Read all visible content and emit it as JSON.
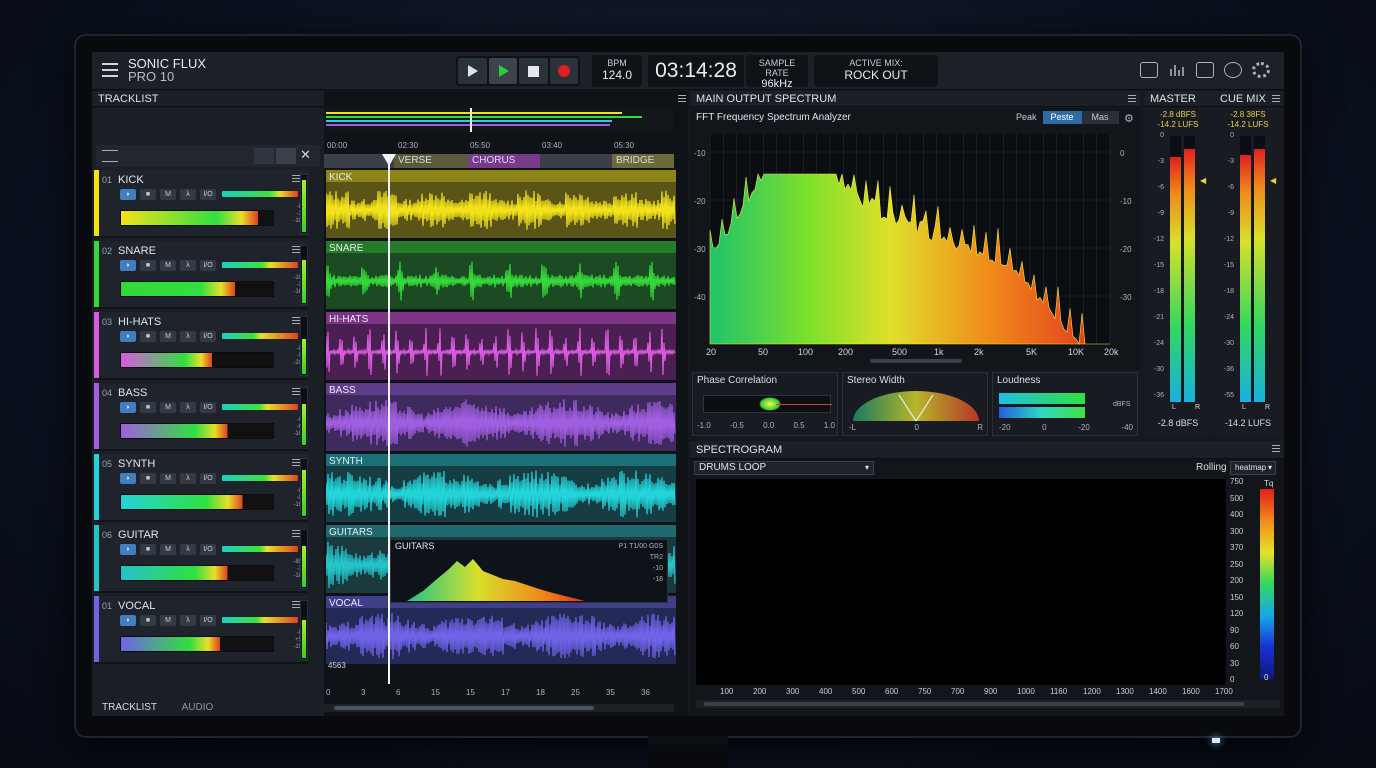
{
  "app": {
    "name_line1": "SONIC FLUX",
    "name_line2": "PRO 10"
  },
  "transport": {
    "bpm_label": "BPM",
    "bpm_value": "124.0",
    "time": "03:14:28",
    "sample_rate_label": "SAMPLE RATE",
    "sample_rate_value": "96kHz",
    "active_mix_label": "ACTIVE MIX:",
    "active_mix_value": "ROCK OUT"
  },
  "tracklist": {
    "title": "TRACKLIST",
    "footer_tabs": [
      "TRACKLIST",
      "AUDIO"
    ]
  },
  "timeline": {
    "times": [
      "00:00",
      "02:30",
      "05:50",
      "03:40",
      "05:30"
    ],
    "markers": [
      "VERSE",
      "CHORUS",
      "BRIDGE"
    ],
    "bottom_ticks": [
      "0",
      "3",
      "6",
      "15",
      "15",
      "17",
      "18",
      "25",
      "35",
      "36"
    ]
  },
  "tracks": [
    {
      "num": "01",
      "name": "KICK",
      "color": "#f2e21a",
      "levels": [
        "-8",
        "-3",
        "-10"
      ],
      "meter": 0.9
    },
    {
      "num": "02",
      "name": "SNARE",
      "color": "#35d83a",
      "levels": [
        "-10",
        "-3",
        "-16"
      ],
      "meter": 0.75
    },
    {
      "num": "03",
      "name": "HI-HATS",
      "color": "#d95be0",
      "levels": [
        "-8",
        "-5",
        "-20"
      ],
      "meter": 0.6
    },
    {
      "num": "04",
      "name": "BASS",
      "color": "#a05ee0",
      "levels": [
        "-8",
        "-6",
        "-10"
      ],
      "meter": 0.7
    },
    {
      "num": "05",
      "name": "SYNTH",
      "color": "#22d4d8",
      "levels": [
        "-8",
        "-0",
        "-16"
      ],
      "meter": 0.8
    },
    {
      "num": "06",
      "name": "GUITAR",
      "color": "#24c3c9",
      "levels": [
        "-89",
        "-3",
        "-18"
      ],
      "meter": 0.7
    },
    {
      "num": "01",
      "name": "VOCAL",
      "color": "#6f63e6",
      "levels": [
        "-8",
        "+5",
        "-15"
      ],
      "meter": 0.65
    }
  ],
  "lanes": [
    "KICK",
    "SNARE",
    "HI-HATS",
    "BASS",
    "SYNTH",
    "GUITARS",
    "VOCAL"
  ],
  "guitar_inset": {
    "title": "GUITARS",
    "labels": [
      "-10",
      "-15",
      "-20",
      "-30",
      "-35"
    ],
    "right": [
      "P1",
      "T1/00",
      "G0S",
      "TR2",
      "-10",
      "-18"
    ]
  },
  "vocal_tag": "4563",
  "main_spectrum": {
    "title": "MAIN OUTPUT SPECTRUM",
    "subtitle": "FFT Frequency Spectrum Analyzer",
    "modes": [
      "Peak",
      "Peste",
      "Mas"
    ],
    "y_left": [
      "-10",
      "-20",
      "-30",
      "-40"
    ],
    "y_right": [
      "0",
      "-10",
      "-20",
      "-30"
    ],
    "x": [
      "20",
      "50",
      "100",
      "200",
      "500",
      "1k",
      "2k",
      "5K",
      "10K",
      "20k"
    ]
  },
  "phase": {
    "title": "Phase Correlation",
    "ticks": [
      "-1.0",
      "-0.5",
      "0.0",
      "0.5",
      "1.0"
    ]
  },
  "stereo": {
    "title": "Stereo Width",
    "ticks": [
      "-L",
      "0",
      "R"
    ]
  },
  "loudness": {
    "title": "Loudness",
    "unit": "dBFS",
    "ticks": [
      "-20",
      "0",
      "-20",
      "-40"
    ]
  },
  "master": {
    "title": "MASTER O...",
    "dbfs": "-2.8 dBFS",
    "lufs": "-14.2 LUFS",
    "scale": [
      "0",
      "-3",
      "-6",
      "-9",
      "-12",
      "-15",
      "-18",
      "-21",
      "-24",
      "-30",
      "-36"
    ],
    "lr": [
      "L",
      "R"
    ],
    "bottom": "-2.8 dBFS"
  },
  "cue": {
    "title": "CUE MIX",
    "dbfs": "-2.8 38FS",
    "lufs": "-14.2 LUFS",
    "scale": [
      "0",
      "-3",
      "-6",
      "-9",
      "-12",
      "-15",
      "-18",
      "-24",
      "-30",
      "-36",
      "-55"
    ],
    "lr": [
      "L",
      "R"
    ],
    "bottom": "-14.2 LUFS"
  },
  "spectrogram": {
    "title": "SPECTROGRAM",
    "source": "DRUMS LOOP",
    "mode_label": "Rolling",
    "mode_select": "heatmap",
    "x": [
      "100",
      "200",
      "300",
      "400",
      "500",
      "600",
      "750",
      "700",
      "900",
      "1000",
      "1160",
      "1200",
      "1300",
      "1400",
      "1600",
      "1700"
    ],
    "y": [
      "750",
      "500",
      "400",
      "300",
      "370",
      "250",
      "200",
      "150",
      "120",
      "90",
      "60",
      "30",
      "0"
    ],
    "legend_top": "Tq",
    "legend_bottom": "0"
  },
  "colors": {
    "accent": "#3f7fc0",
    "record": "#e02020",
    "play": "#2ccc3a"
  }
}
